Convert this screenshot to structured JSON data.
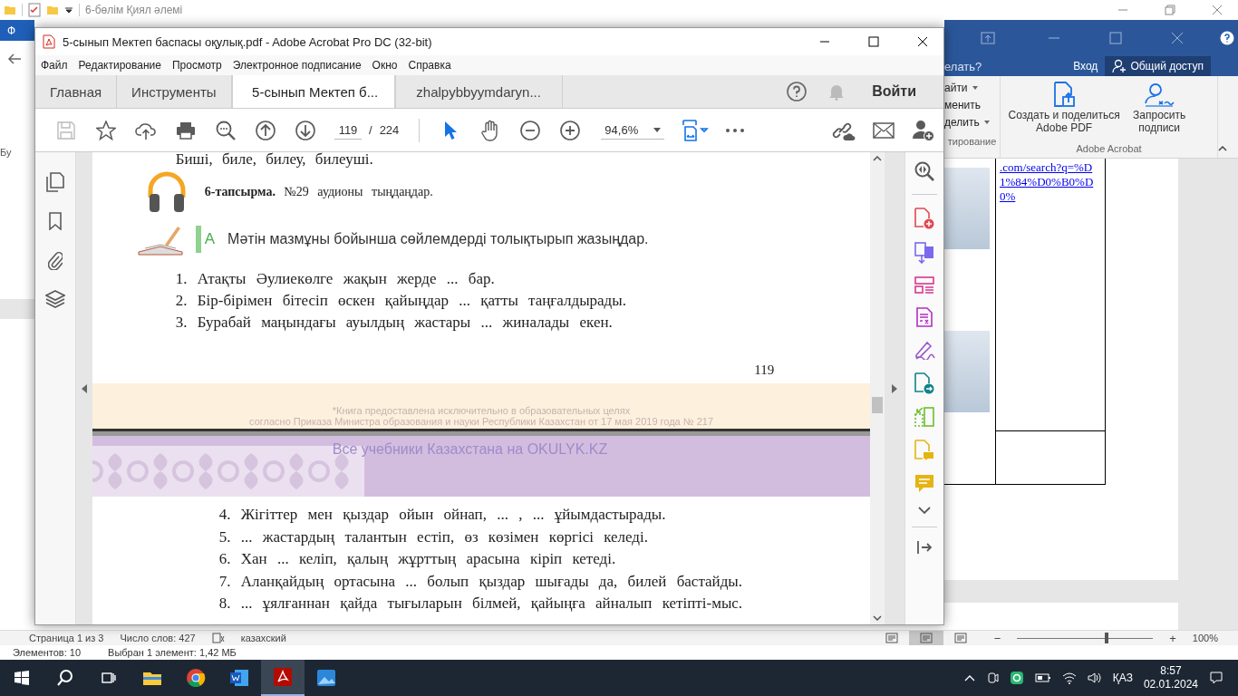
{
  "explorer": {
    "title": "6-бөлім Қиял әлемі",
    "status": [
      "Элементов: 10",
      "Выбран 1 элемент: 1,42 МБ"
    ]
  },
  "word": {
    "file_tab": "Ф",
    "clipboard_group": "Бу",
    "tell_me": "елать?",
    "sign_in": "Вход",
    "share": "Общий доступ",
    "ribbon_left": [
      {
        "label": "айти",
        "dropdown": true
      },
      {
        "label": "менить",
        "dropdown": false
      },
      {
        "label": "делить",
        "dropdown": true
      }
    ],
    "group_left": "тирование",
    "acrobat_buttons": [
      "Создать и поделиться Adobe PDF",
      "Запросить подписи"
    ],
    "group_acrobat": "Adobe Acrobat",
    "link": ".com/search?q=%D1%84%D0%B0%D0%",
    "status": {
      "page": "Страница 1 из 3",
      "words": "Число слов: 427",
      "language": "казахский",
      "views": [
        {
          "selected": false
        },
        {
          "selected": true
        },
        {
          "selected": false
        }
      ],
      "zoom_out": "−",
      "zoom_in": "+",
      "zoom_slider": {
        "level": 0.66
      },
      "zoom": "100%"
    }
  },
  "acrobat": {
    "title": "5-сынып Мектеп баспасы оқулық.pdf - Adobe Acrobat Pro DC (32-bit)",
    "menu": [
      "Файл",
      "Редактирование",
      "Просмотр",
      "Электронное подписание",
      "Окно",
      "Справка"
    ],
    "tabs": [
      {
        "label": "Главная",
        "selected": false
      },
      {
        "label": "Инструменты",
        "selected": false
      },
      {
        "label": "5-сынып Мектеп б...",
        "selected": true
      },
      {
        "label": "zhalpybbyymdaryn...",
        "selected": false
      }
    ],
    "sign_in": "Войти",
    "page_current": "119",
    "page_sep": "/",
    "page_total": "224",
    "zoom": "94,6%",
    "page_1": {
      "cut_line": "Биші, биле, билеу, билеуші.",
      "task": "**6-тапсырма.** №29 аудионы тыңдаңдар.",
      "section_letter": "А",
      "instruction": "Мәтін мазмұны бойынша сөйлемдерді толықтырып жазыңдар.",
      "items": [
        "1. Атақты Әулиекөлге жақын жерде ... бар.",
        "2. Бір-бірімен бітесіп өскен қайыңдар ... қатты таңғалдырады.",
        "3. Бурабай маңындағы ауылдың жастары ... жиналады екен."
      ],
      "page_number": "119"
    },
    "footer_note": [
      "*Книга предоставлена исключительно в образовательных целях",
      "согласно Приказа Министра образования и науки Республики Казахстан от 17 мая 2019 года № 217"
    ],
    "banner": "Все учебники Казахстана на OKULYK.KZ",
    "page_2": {
      "items": [
        "4. Жігіттер мен қыздар ойын ойнап, ... , ... ұйымдастырады.",
        "5. ... жастардың талантын естіп, өз көзімен көргісі келеді.",
        "6. Хан ... келіп, қалың жұрттың арасына кіріп кетеді.",
        "7. Аланқайдың ортасына ... болып қыздар шығады да, билей бастайды.",
        "8. ... ұялғаннан қайда тығыларын білмей, қайыңға айналып кетіпті-мыс."
      ]
    }
  },
  "taskbar": {
    "apps": [
      {
        "kind": "explorer",
        "selected": false
      },
      {
        "kind": "chrome",
        "selected": false
      },
      {
        "kind": "word",
        "selected": false
      },
      {
        "kind": "acrobat",
        "selected": true
      },
      {
        "kind": "photos",
        "selected": false
      }
    ],
    "language": "ҚАЗ",
    "time": "8:57",
    "date": "02.01.2024"
  }
}
